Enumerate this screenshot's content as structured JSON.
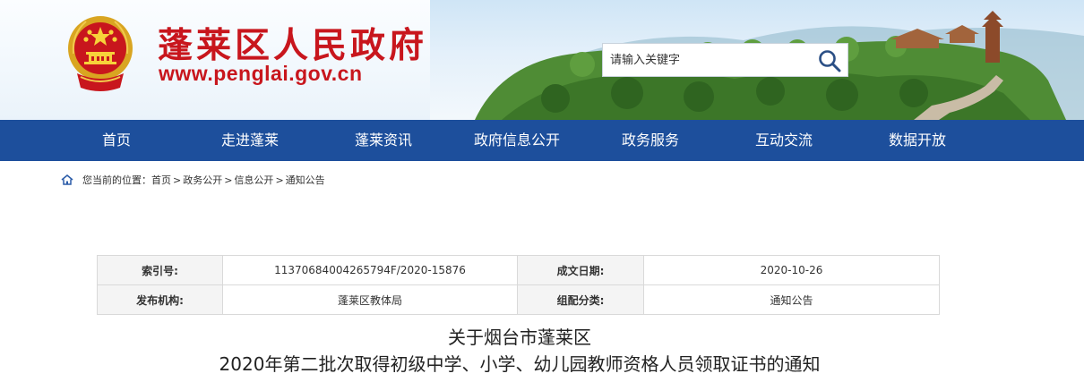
{
  "header": {
    "site_title": "蓬莱区人民政府",
    "site_url": "www.penglai.gov.cn",
    "emblem_icon": "national-emblem-icon",
    "brand_color": "#c8161d"
  },
  "search": {
    "placeholder": "请输入关键字",
    "icon": "search-icon"
  },
  "nav": {
    "background": "#1d4f9c",
    "items": [
      {
        "label": "首页"
      },
      {
        "label": "走进蓬莱"
      },
      {
        "label": "蓬莱资讯"
      },
      {
        "label": "政府信息公开"
      },
      {
        "label": "政务服务"
      },
      {
        "label": "互动交流"
      },
      {
        "label": "数据开放"
      }
    ]
  },
  "breadcrumb": {
    "icon": "home-icon",
    "prefix": "您当前的位置：",
    "items": [
      "首页",
      "政务公开",
      "信息公开",
      "通知公告"
    ],
    "separator": ">"
  },
  "info": {
    "index_label": "索引号:",
    "index_value": "11370684004265794F/2020-15876",
    "date_label": "成文日期:",
    "date_value": "2020-10-26",
    "publisher_label": "发布机构:",
    "publisher_value": "蓬莱区教体局",
    "category_label": "组配分类:",
    "category_value": "通知公告"
  },
  "article": {
    "title_line1": "关于烟台市蓬莱区",
    "title_line2": "2020年第二批次取得初级中学、小学、幼儿园教师资格人员领取证书的通知"
  }
}
